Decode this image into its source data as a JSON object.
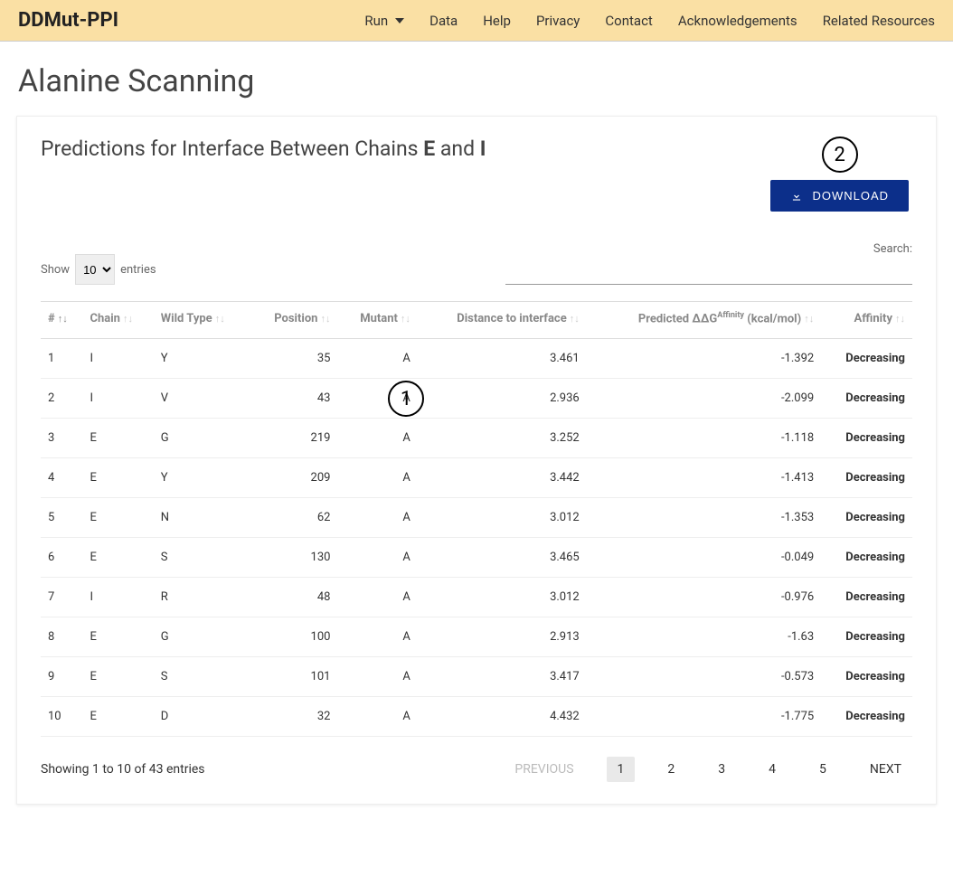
{
  "nav": {
    "brand": "DDMut-PPI",
    "items": [
      "Run",
      "Data",
      "Help",
      "Privacy",
      "Contact",
      "Acknowledgements",
      "Related Resources"
    ]
  },
  "page_title": "Alanine Scanning",
  "card": {
    "title_prefix": "Predictions for Interface Between Chains ",
    "chain_a": "E",
    "and": " and ",
    "chain_b": "I",
    "download_label": "DOWNLOAD",
    "marker1": "1",
    "marker2": "2"
  },
  "table_controls": {
    "show_label": "Show",
    "entries_label": "entries",
    "page_size": "10",
    "search_label": "Search:"
  },
  "columns": {
    "num": "#",
    "chain": "Chain",
    "wt": "Wild Type",
    "pos": "Position",
    "mut": "Mutant",
    "dist": "Distance to interface",
    "ddg_pre": "Predicted ΔΔG",
    "ddg_sup": "Affinity",
    "ddg_unit": " (kcal/mol)",
    "aff": "Affinity"
  },
  "rows": [
    {
      "n": "1",
      "chain": "I",
      "wt": "Y",
      "pos": "35",
      "mut": "A",
      "dist": "3.461",
      "ddg": "-1.392",
      "aff": "Decreasing"
    },
    {
      "n": "2",
      "chain": "I",
      "wt": "V",
      "pos": "43",
      "mut": "A",
      "dist": "2.936",
      "ddg": "-2.099",
      "aff": "Decreasing"
    },
    {
      "n": "3",
      "chain": "E",
      "wt": "G",
      "pos": "219",
      "mut": "A",
      "dist": "3.252",
      "ddg": "-1.118",
      "aff": "Decreasing"
    },
    {
      "n": "4",
      "chain": "E",
      "wt": "Y",
      "pos": "209",
      "mut": "A",
      "dist": "3.442",
      "ddg": "-1.413",
      "aff": "Decreasing"
    },
    {
      "n": "5",
      "chain": "E",
      "wt": "N",
      "pos": "62",
      "mut": "A",
      "dist": "3.012",
      "ddg": "-1.353",
      "aff": "Decreasing"
    },
    {
      "n": "6",
      "chain": "E",
      "wt": "S",
      "pos": "130",
      "mut": "A",
      "dist": "3.465",
      "ddg": "-0.049",
      "aff": "Decreasing"
    },
    {
      "n": "7",
      "chain": "I",
      "wt": "R",
      "pos": "48",
      "mut": "A",
      "dist": "3.012",
      "ddg": "-0.976",
      "aff": "Decreasing"
    },
    {
      "n": "8",
      "chain": "E",
      "wt": "G",
      "pos": "100",
      "mut": "A",
      "dist": "2.913",
      "ddg": "-1.63",
      "aff": "Decreasing"
    },
    {
      "n": "9",
      "chain": "E",
      "wt": "S",
      "pos": "101",
      "mut": "A",
      "dist": "3.417",
      "ddg": "-0.573",
      "aff": "Decreasing"
    },
    {
      "n": "10",
      "chain": "E",
      "wt": "D",
      "pos": "32",
      "mut": "A",
      "dist": "4.432",
      "ddg": "-1.775",
      "aff": "Decreasing"
    }
  ],
  "footer": {
    "info": "Showing 1 to 10 of 43 entries",
    "prev": "PREVIOUS",
    "next": "NEXT",
    "pages": [
      "1",
      "2",
      "3",
      "4",
      "5"
    ],
    "active": "1"
  }
}
